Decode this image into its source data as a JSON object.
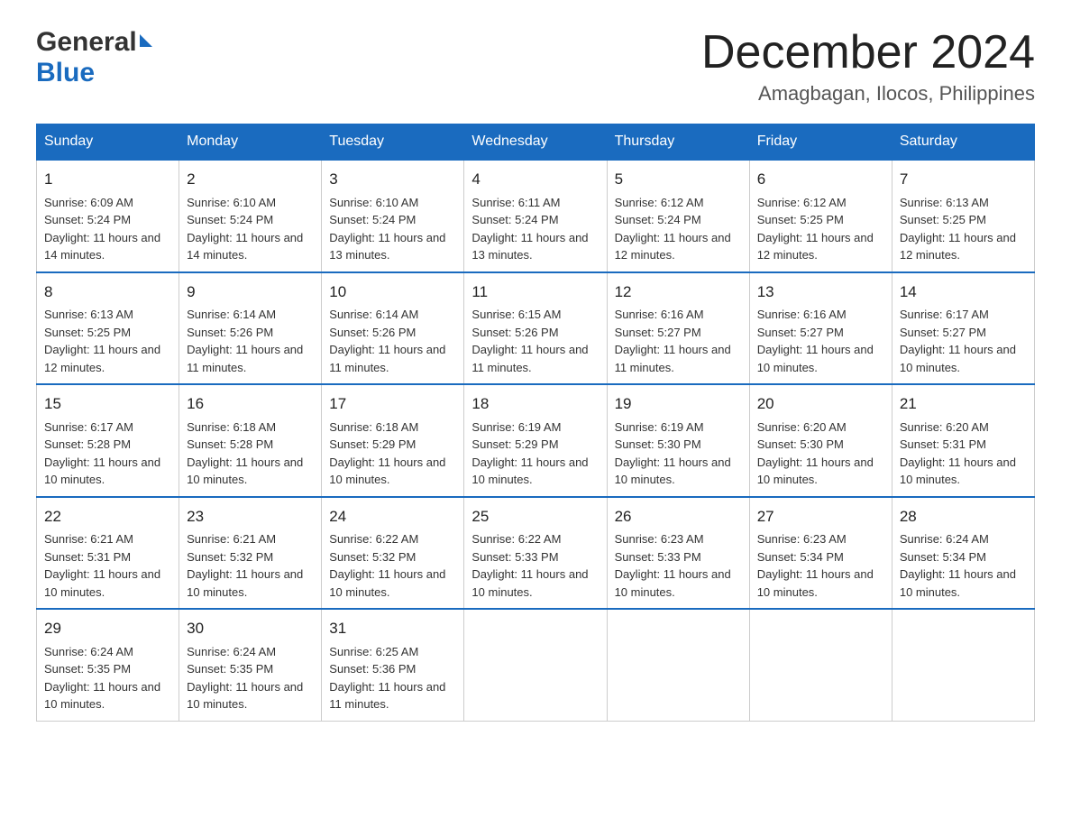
{
  "header": {
    "logo_general": "General",
    "logo_blue": "Blue",
    "month_title": "December 2024",
    "location": "Amagbagan, Ilocos, Philippines"
  },
  "weekdays": [
    "Sunday",
    "Monday",
    "Tuesday",
    "Wednesday",
    "Thursday",
    "Friday",
    "Saturday"
  ],
  "weeks": [
    [
      {
        "day": "1",
        "sunrise": "6:09 AM",
        "sunset": "5:24 PM",
        "daylight": "11 hours and 14 minutes."
      },
      {
        "day": "2",
        "sunrise": "6:10 AM",
        "sunset": "5:24 PM",
        "daylight": "11 hours and 14 minutes."
      },
      {
        "day": "3",
        "sunrise": "6:10 AM",
        "sunset": "5:24 PM",
        "daylight": "11 hours and 13 minutes."
      },
      {
        "day": "4",
        "sunrise": "6:11 AM",
        "sunset": "5:24 PM",
        "daylight": "11 hours and 13 minutes."
      },
      {
        "day": "5",
        "sunrise": "6:12 AM",
        "sunset": "5:24 PM",
        "daylight": "11 hours and 12 minutes."
      },
      {
        "day": "6",
        "sunrise": "6:12 AM",
        "sunset": "5:25 PM",
        "daylight": "11 hours and 12 minutes."
      },
      {
        "day": "7",
        "sunrise": "6:13 AM",
        "sunset": "5:25 PM",
        "daylight": "11 hours and 12 minutes."
      }
    ],
    [
      {
        "day": "8",
        "sunrise": "6:13 AM",
        "sunset": "5:25 PM",
        "daylight": "11 hours and 12 minutes."
      },
      {
        "day": "9",
        "sunrise": "6:14 AM",
        "sunset": "5:26 PM",
        "daylight": "11 hours and 11 minutes."
      },
      {
        "day": "10",
        "sunrise": "6:14 AM",
        "sunset": "5:26 PM",
        "daylight": "11 hours and 11 minutes."
      },
      {
        "day": "11",
        "sunrise": "6:15 AM",
        "sunset": "5:26 PM",
        "daylight": "11 hours and 11 minutes."
      },
      {
        "day": "12",
        "sunrise": "6:16 AM",
        "sunset": "5:27 PM",
        "daylight": "11 hours and 11 minutes."
      },
      {
        "day": "13",
        "sunrise": "6:16 AM",
        "sunset": "5:27 PM",
        "daylight": "11 hours and 10 minutes."
      },
      {
        "day": "14",
        "sunrise": "6:17 AM",
        "sunset": "5:27 PM",
        "daylight": "11 hours and 10 minutes."
      }
    ],
    [
      {
        "day": "15",
        "sunrise": "6:17 AM",
        "sunset": "5:28 PM",
        "daylight": "11 hours and 10 minutes."
      },
      {
        "day": "16",
        "sunrise": "6:18 AM",
        "sunset": "5:28 PM",
        "daylight": "11 hours and 10 minutes."
      },
      {
        "day": "17",
        "sunrise": "6:18 AM",
        "sunset": "5:29 PM",
        "daylight": "11 hours and 10 minutes."
      },
      {
        "day": "18",
        "sunrise": "6:19 AM",
        "sunset": "5:29 PM",
        "daylight": "11 hours and 10 minutes."
      },
      {
        "day": "19",
        "sunrise": "6:19 AM",
        "sunset": "5:30 PM",
        "daylight": "11 hours and 10 minutes."
      },
      {
        "day": "20",
        "sunrise": "6:20 AM",
        "sunset": "5:30 PM",
        "daylight": "11 hours and 10 minutes."
      },
      {
        "day": "21",
        "sunrise": "6:20 AM",
        "sunset": "5:31 PM",
        "daylight": "11 hours and 10 minutes."
      }
    ],
    [
      {
        "day": "22",
        "sunrise": "6:21 AM",
        "sunset": "5:31 PM",
        "daylight": "11 hours and 10 minutes."
      },
      {
        "day": "23",
        "sunrise": "6:21 AM",
        "sunset": "5:32 PM",
        "daylight": "11 hours and 10 minutes."
      },
      {
        "day": "24",
        "sunrise": "6:22 AM",
        "sunset": "5:32 PM",
        "daylight": "11 hours and 10 minutes."
      },
      {
        "day": "25",
        "sunrise": "6:22 AM",
        "sunset": "5:33 PM",
        "daylight": "11 hours and 10 minutes."
      },
      {
        "day": "26",
        "sunrise": "6:23 AM",
        "sunset": "5:33 PM",
        "daylight": "11 hours and 10 minutes."
      },
      {
        "day": "27",
        "sunrise": "6:23 AM",
        "sunset": "5:34 PM",
        "daylight": "11 hours and 10 minutes."
      },
      {
        "day": "28",
        "sunrise": "6:24 AM",
        "sunset": "5:34 PM",
        "daylight": "11 hours and 10 minutes."
      }
    ],
    [
      {
        "day": "29",
        "sunrise": "6:24 AM",
        "sunset": "5:35 PM",
        "daylight": "11 hours and 10 minutes."
      },
      {
        "day": "30",
        "sunrise": "6:24 AM",
        "sunset": "5:35 PM",
        "daylight": "11 hours and 10 minutes."
      },
      {
        "day": "31",
        "sunrise": "6:25 AM",
        "sunset": "5:36 PM",
        "daylight": "11 hours and 11 minutes."
      },
      null,
      null,
      null,
      null
    ]
  ],
  "labels": {
    "sunrise": "Sunrise:",
    "sunset": "Sunset:",
    "daylight": "Daylight:"
  },
  "colors": {
    "header_bg": "#1a6bbf",
    "header_text": "#ffffff",
    "border_top": "#1a6bbf"
  }
}
